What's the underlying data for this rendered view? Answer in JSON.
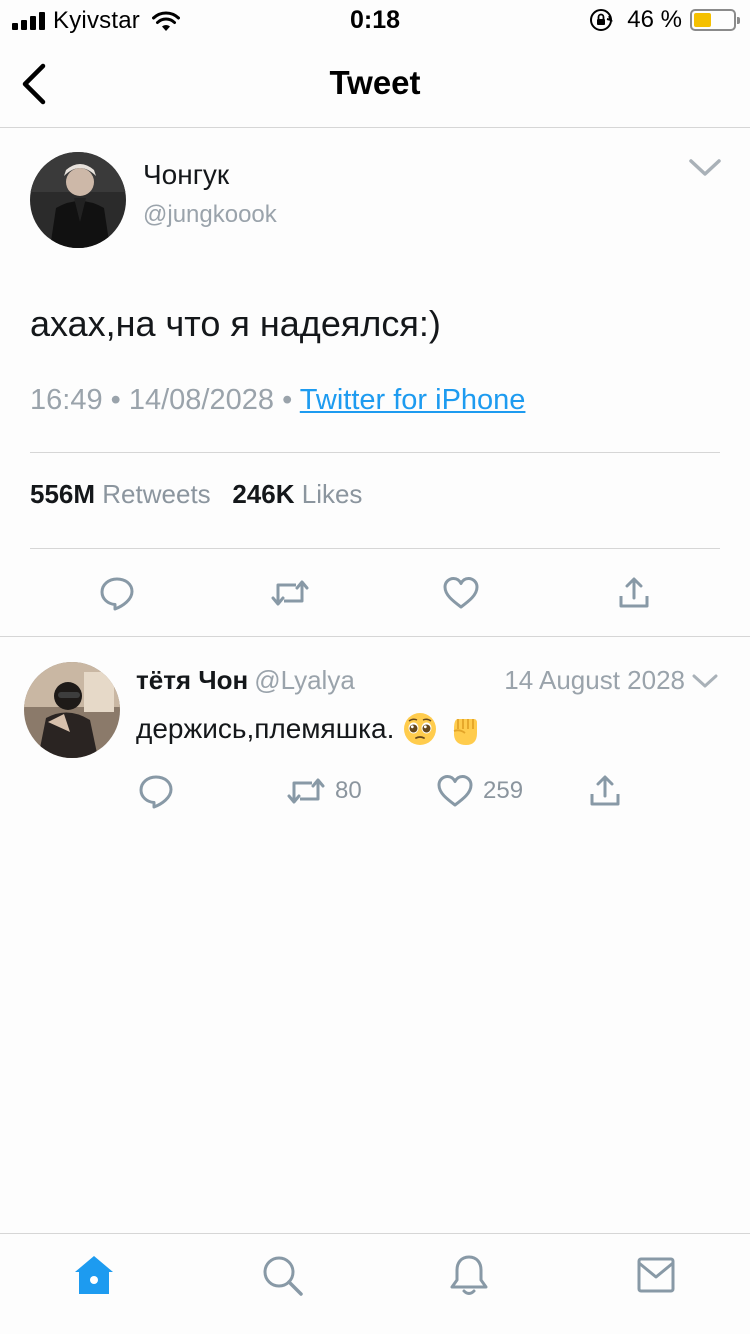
{
  "status_bar": {
    "carrier": "Kyivstar",
    "time": "0:18",
    "battery_percent": "46 %",
    "battery_level": 0.46,
    "icons": [
      "signal-icon",
      "wifi-icon",
      "orientation-lock-icon",
      "battery-icon"
    ]
  },
  "header": {
    "title": "Tweet",
    "back_icon": "chevron-left-icon"
  },
  "tweet": {
    "author_name": "Чонгук",
    "author_handle": "@jungkoook",
    "text": "ахах,на что я надеялся:)",
    "time": "16:49",
    "separator": "•",
    "date": "14/08/2028",
    "source": "Twitter for iPhone",
    "retweets_count": "556M",
    "retweets_label": "Retweets",
    "likes_count": "246K",
    "likes_label": "Likes",
    "actions": [
      "reply-icon",
      "retweet-icon",
      "like-icon",
      "share-icon"
    ]
  },
  "reply": {
    "author_name": "тётя Чон",
    "author_handle": "@Lyalya",
    "date": "14 August 2028",
    "text": "держись,племяшка.",
    "emojis": [
      "pleading-face-emoji",
      "raised-fist-emoji"
    ],
    "retweets": "80",
    "likes": "259"
  },
  "tabbar": {
    "tabs": [
      "home-icon",
      "search-icon",
      "notifications-icon",
      "messages-icon"
    ],
    "active": "home-icon"
  },
  "colors": {
    "accent": "#1d9bf0",
    "muted": "#9aa3ab",
    "icon": "#8899a6",
    "battery": "#f5c000"
  }
}
